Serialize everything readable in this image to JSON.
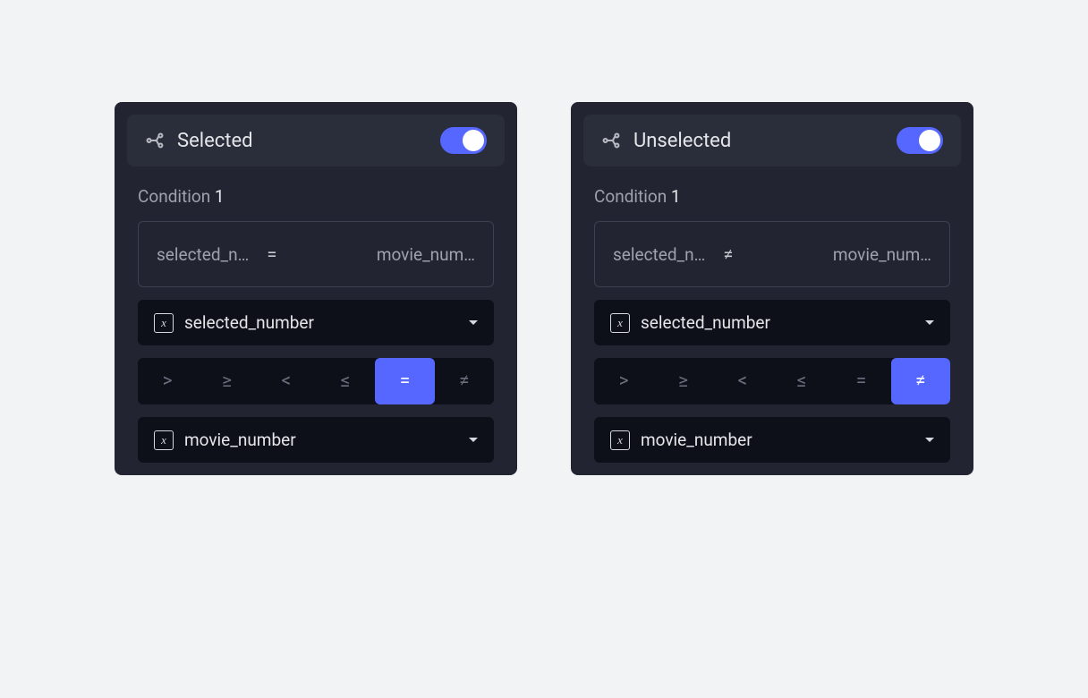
{
  "panels": [
    {
      "title": "Selected",
      "toggle_on": true,
      "condition_label": "Condition",
      "condition_number": "1",
      "expression": {
        "lhs": "selected_n…",
        "op": "=",
        "rhs": "movie_num…"
      },
      "var_dropdown_a": "selected_number",
      "operators": [
        ">",
        "≥",
        "<",
        "≤",
        "=",
        "≠"
      ],
      "selected_op_index": 4,
      "var_dropdown_b": "movie_number"
    },
    {
      "title": "Unselected",
      "toggle_on": true,
      "condition_label": "Condition",
      "condition_number": "1",
      "expression": {
        "lhs": "selected_n…",
        "op": "≠",
        "rhs": "movie_num…"
      },
      "var_dropdown_a": "selected_number",
      "operators": [
        ">",
        "≥",
        "<",
        "≤",
        "=",
        "≠"
      ],
      "selected_op_index": 5,
      "var_dropdown_b": "movie_number"
    }
  ]
}
